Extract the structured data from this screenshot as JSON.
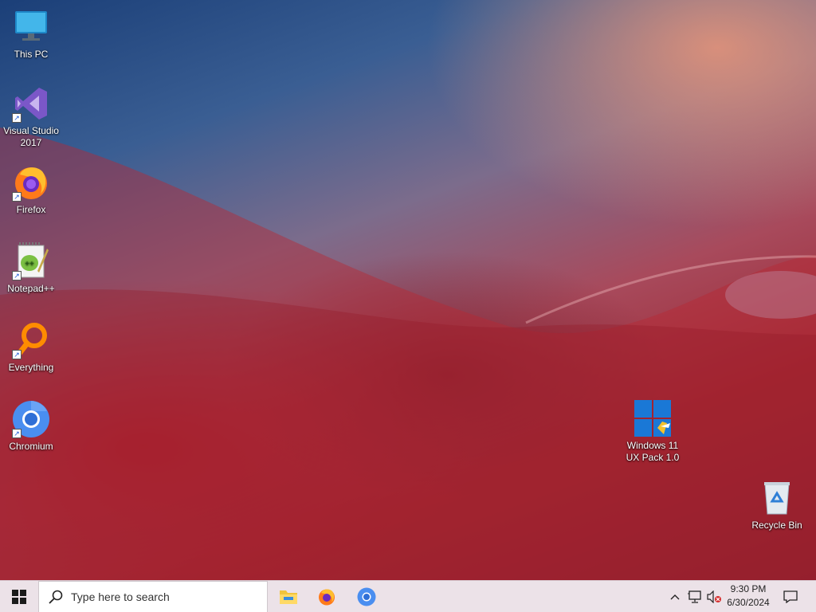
{
  "desktop": {
    "icons": [
      {
        "label": "This PC",
        "icon": "monitor-icon"
      },
      {
        "label": "Visual Studio 2017",
        "icon": "visual-studio-icon"
      },
      {
        "label": "Firefox",
        "icon": "firefox-icon"
      },
      {
        "label": "Notepad++",
        "icon": "notepad-plus-plus-icon"
      },
      {
        "label": "Everything",
        "icon": "everything-search-icon"
      },
      {
        "label": "Chromium",
        "icon": "chromium-icon"
      },
      {
        "label": "Windows 11 UX Pack 1.0",
        "icon": "windows-logo-icon"
      },
      {
        "label": "Recycle Bin",
        "icon": "recycle-bin-icon"
      }
    ]
  },
  "taskbar": {
    "start_icon": "windows-start-icon",
    "search": {
      "placeholder": "Type here to search",
      "icon": "search-icon"
    },
    "pinned": [
      {
        "name": "File Explorer",
        "icon": "folder-icon"
      },
      {
        "name": "Firefox",
        "icon": "firefox-icon"
      },
      {
        "name": "Chromium",
        "icon": "chromium-icon"
      }
    ],
    "tray": {
      "chevron_icon": "chevron-up-icon",
      "network_icon": "network-icon",
      "volume_icon": "volume-muted-icon",
      "notification_icon": "action-center-icon"
    },
    "clock": {
      "time": "9:30 PM",
      "date": "6/30/2024"
    }
  },
  "colors": {
    "taskbar_bg": "#ece2e8",
    "search_bg": "#ffffff",
    "desktop_text": "#ffffff"
  }
}
